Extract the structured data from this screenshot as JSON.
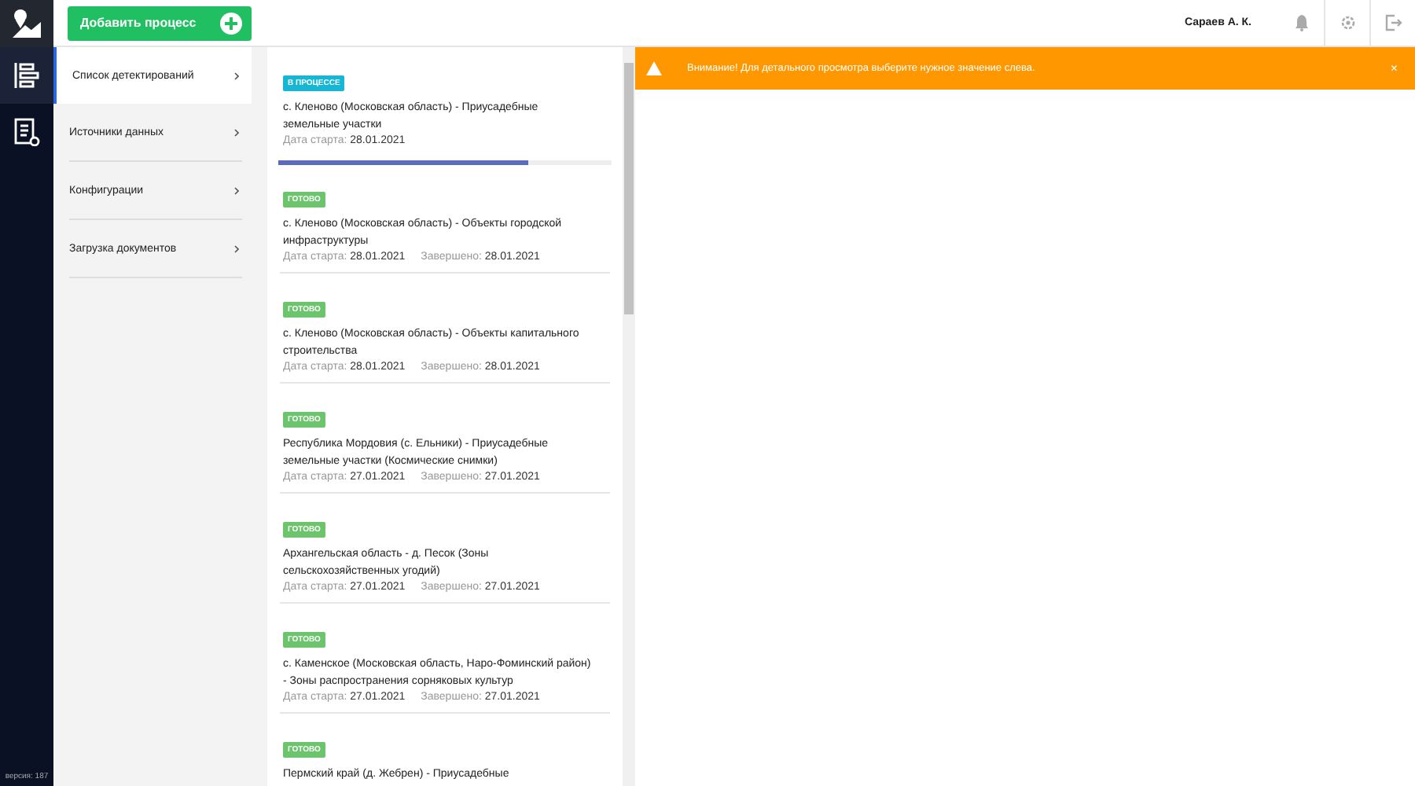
{
  "add_button": {
    "label": "Добавить процесс"
  },
  "user": {
    "name": "Сараев А. К."
  },
  "nav": [
    {
      "label": "Список детектирований",
      "selected": true
    },
    {
      "label": "Источники данных",
      "selected": false
    },
    {
      "label": "Конфигурации",
      "selected": false
    },
    {
      "label": "Загрузка документов",
      "selected": false
    }
  ],
  "processes": [
    {
      "kind": "in_progress",
      "badge": "В ПРОЦЕССЕ",
      "title": "с. Кленово (Московская область) - Приусадебные земельные участки",
      "start_label": "Дата старта:",
      "start": "28.01.2021",
      "level": 0.75
    },
    {
      "kind": "done",
      "badge": "ГОТОВО",
      "title": "с. Кленово (Московская область) - Объекты городской инфраструктуры",
      "start_label": "Дата старта:",
      "start": "28.01.2021",
      "end_label": "Завершено:",
      "end": "28.01.2021"
    },
    {
      "kind": "done",
      "badge": "ГОТОВО",
      "title": "с. Кленово (Московская область) - Объекты капитального строительства",
      "start_label": "Дата старта:",
      "start": "28.01.2021",
      "end_label": "Завершено:",
      "end": "28.01.2021"
    },
    {
      "kind": "done",
      "badge": "ГОТОВО",
      "title": "Республика Мордовия (с. Ельники) - Приусадебные земельные участки (Космические снимки)",
      "start_label": "Дата старта:",
      "start": "27.01.2021",
      "end_label": "Завершено:",
      "end": "27.01.2021"
    },
    {
      "kind": "done",
      "badge": "ГОТОВО",
      "title": "Архангельская область - д. Песок (Зоны сельскохозяйственных угодий)",
      "start_label": "Дата старта:",
      "start": "27.01.2021",
      "end_label": "Завершено:",
      "end": "27.01.2021"
    },
    {
      "kind": "done",
      "badge": "ГОТОВО",
      "title": "с. Каменское (Московская область, Наро-Фоминский район) - Зоны распространения сорняковых культур",
      "start_label": "Дата старта:",
      "start": "27.01.2021",
      "end_label": "Завершено:",
      "end": "27.01.2021"
    },
    {
      "kind": "done",
      "badge": "ГОТОВО",
      "title": "Пермский край (д. Жебрен) - Приусадебные"
    }
  ],
  "alert": {
    "message": "Внимание! Для детального просмотра выберите нужное значение слева.",
    "close": "×"
  },
  "version": "версия: 187"
}
